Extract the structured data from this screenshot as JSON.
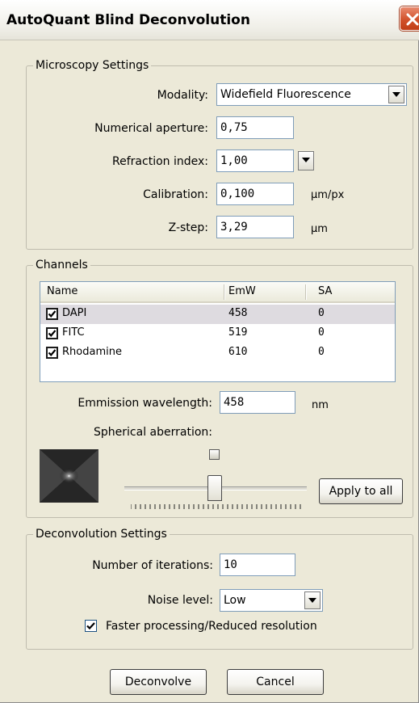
{
  "window": {
    "title": "AutoQuant Blind Deconvolution"
  },
  "microscopy": {
    "legend": "Microscopy Settings",
    "modality": {
      "label": "Modality:",
      "value": "Widefield Fluorescence"
    },
    "numerical_aperture": {
      "label": "Numerical aperture:",
      "value": "0,75"
    },
    "refraction_index": {
      "label": "Refraction index:",
      "value": "1,00"
    },
    "calibration": {
      "label": "Calibration:",
      "value": "0,100",
      "unit": "µm/px"
    },
    "z_step": {
      "label": "Z-step:",
      "value": "3,29",
      "unit": "µm"
    }
  },
  "channels": {
    "legend": "Channels",
    "columns": [
      "Name",
      "EmW",
      "SA"
    ],
    "rows": [
      {
        "name": "DAPI",
        "emw": "458",
        "sa": "0",
        "checked": true,
        "selected": true
      },
      {
        "name": "FITC",
        "emw": "519",
        "sa": "0",
        "checked": true,
        "selected": false
      },
      {
        "name": "Rhodamine",
        "emw": "610",
        "sa": "0",
        "checked": true,
        "selected": false
      }
    ],
    "emission": {
      "label": "Emmission wavelength:",
      "value": "458",
      "unit": "nm"
    },
    "spherical": {
      "label": "Spherical aberration:",
      "slider_value_fraction": 0.45
    },
    "apply_all_label": "Apply to all"
  },
  "deconvolution": {
    "legend": "Deconvolution Settings",
    "iterations": {
      "label": "Number of iterations:",
      "value": "10"
    },
    "noise": {
      "label": "Noise level:",
      "value": "Low"
    },
    "faster": {
      "label": "Faster processing/Reduced resolution",
      "checked": true
    }
  },
  "buttons": {
    "deconvolve": "Deconvolve",
    "cancel": "Cancel"
  }
}
